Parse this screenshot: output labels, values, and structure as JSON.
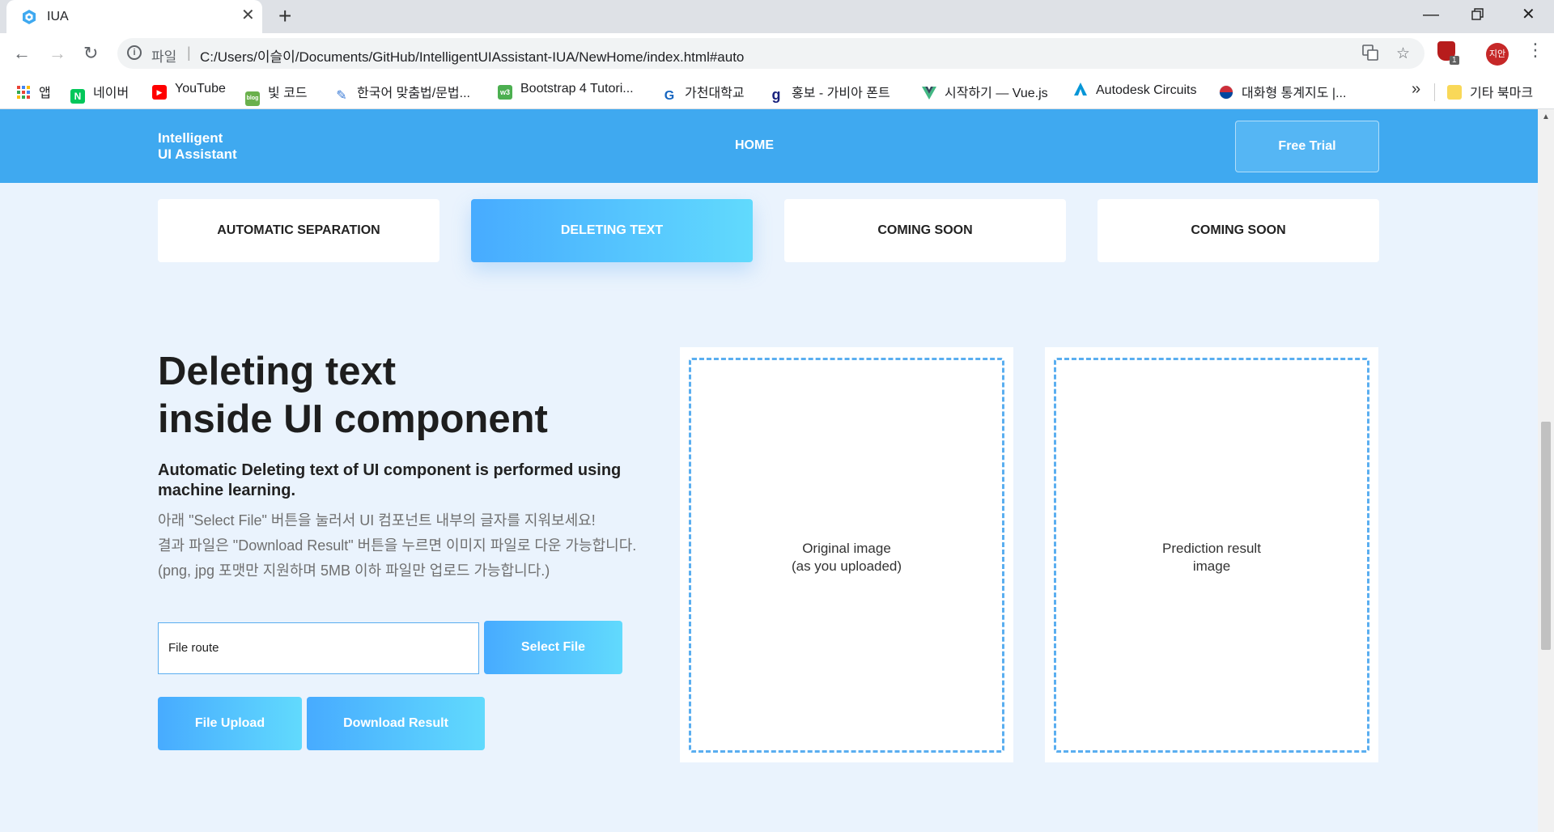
{
  "browser": {
    "tab_title": "IUA",
    "url_scheme": "파일",
    "url": "C:/Users/이슬이/Documents/GitHub/IntelligentUIAssistant-IUA/NewHome/index.html#auto",
    "profile_initials": "지안",
    "extension_badge": "1",
    "bookmarks": [
      {
        "label": "앱",
        "icon": "apps-grid-icon",
        "color": "#e53935"
      },
      {
        "label": "네이버",
        "icon": "naver-icon",
        "color": "#03c75a"
      },
      {
        "label": "YouTube",
        "icon": "youtube-icon",
        "color": "#ff0000"
      },
      {
        "label": "빛 코드",
        "icon": "blog-icon",
        "color": "#6ab04c"
      },
      {
        "label": "한국어 맞춤법/문법...",
        "icon": "spellcheck-icon",
        "color": "#3b7bd6"
      },
      {
        "label": "Bootstrap 4 Tutori...",
        "icon": "w3-icon",
        "color": "#4caf50"
      },
      {
        "label": "가천대학교",
        "icon": "gachon-icon",
        "color": "#1565c0"
      },
      {
        "label": "홍보 - 가비아 폰트",
        "icon": "gabia-icon",
        "color": "#1a237e"
      },
      {
        "label": "시작하기 — Vue.js",
        "icon": "vue-icon",
        "color": "#42b883"
      },
      {
        "label": "Autodesk Circuits",
        "icon": "autodesk-icon",
        "color": "#0696d7"
      },
      {
        "label": "대화형 통계지도 |...",
        "icon": "korea-flag-icon",
        "color": "#cd2e3a"
      }
    ],
    "more_bookmarks": "»",
    "other_bookmarks": "기타 북마크"
  },
  "header": {
    "logo_line1": "Intelligent",
    "logo_line2": "UI Assistant",
    "nav_home": "HOME",
    "free_trial": "Free Trial"
  },
  "tabs": [
    {
      "label": "AUTOMATIC SEPARATION",
      "active": false
    },
    {
      "label": "DELETING TEXT",
      "active": true
    },
    {
      "label": "COMING SOON",
      "active": false
    },
    {
      "label": "COMING SOON",
      "active": false
    }
  ],
  "hero": {
    "title_line1": "Deleting text",
    "title_line2": "inside UI component",
    "subtitle": "Automatic Deleting text of UI component is performed using machine learning.",
    "desc_line1": "아래 \"Select File\" 버튼을 눌러서 UI 컴포넌트 내부의 글자를 지워보세요!",
    "desc_line2": "결과 파일은 \"Download Result\" 버튼을 누르면 이미지 파일로 다운 가능합니다.",
    "desc_line3": "(png, jpg 포맷만 지원하며 5MB 이하 파일만 업로드 가능합니다.)"
  },
  "upload": {
    "file_route_placeholder": "File route",
    "select_file": "Select File",
    "file_upload": "File Upload",
    "download_result": "Download Result"
  },
  "panels": {
    "original_line1": "Original image",
    "original_line2": "(as you uploaded)",
    "result_line1": "Prediction result",
    "result_line2": "image"
  },
  "colors": {
    "header_blue": "#3fa9f0",
    "gradient_start": "#47abff",
    "gradient_end": "#61dafd",
    "page_background": "#eaf3fd"
  }
}
